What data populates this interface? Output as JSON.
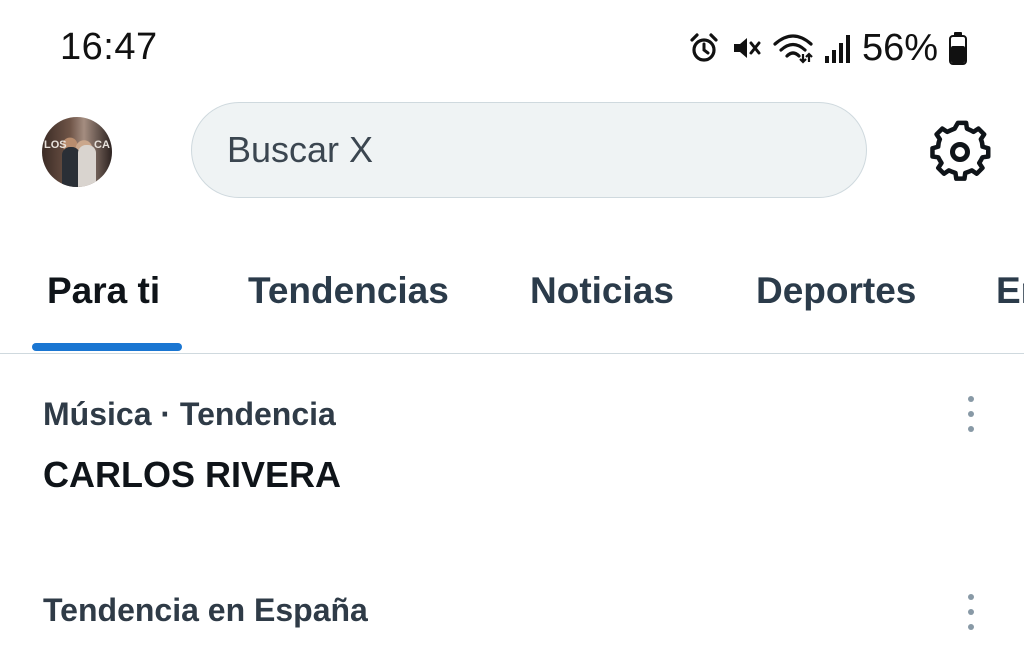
{
  "status_bar": {
    "time": "16:47",
    "battery": "56%",
    "icons": [
      "alarm-icon",
      "mute-icon",
      "wifi-icon",
      "signal-icon",
      "battery-icon"
    ]
  },
  "header": {
    "avatar_letters_left": "LOS",
    "avatar_letters_right": "CA",
    "search_placeholder": "Buscar X",
    "settings_icon": "gear-icon"
  },
  "tabs": [
    {
      "label": "Para ti",
      "active": true
    },
    {
      "label": "Tendencias",
      "active": false
    },
    {
      "label": "Noticias",
      "active": false
    },
    {
      "label": "Deportes",
      "active": false
    },
    {
      "label": "En",
      "active": false
    }
  ],
  "trends": [
    {
      "meta": "Música · Tendencia",
      "title": "CARLOS RIVERA"
    },
    {
      "meta": "Tendencia en España",
      "title": ""
    }
  ],
  "colors": {
    "accent": "#1a76d2",
    "search_bg": "#eff3f4",
    "divider": "#cfd9de"
  }
}
